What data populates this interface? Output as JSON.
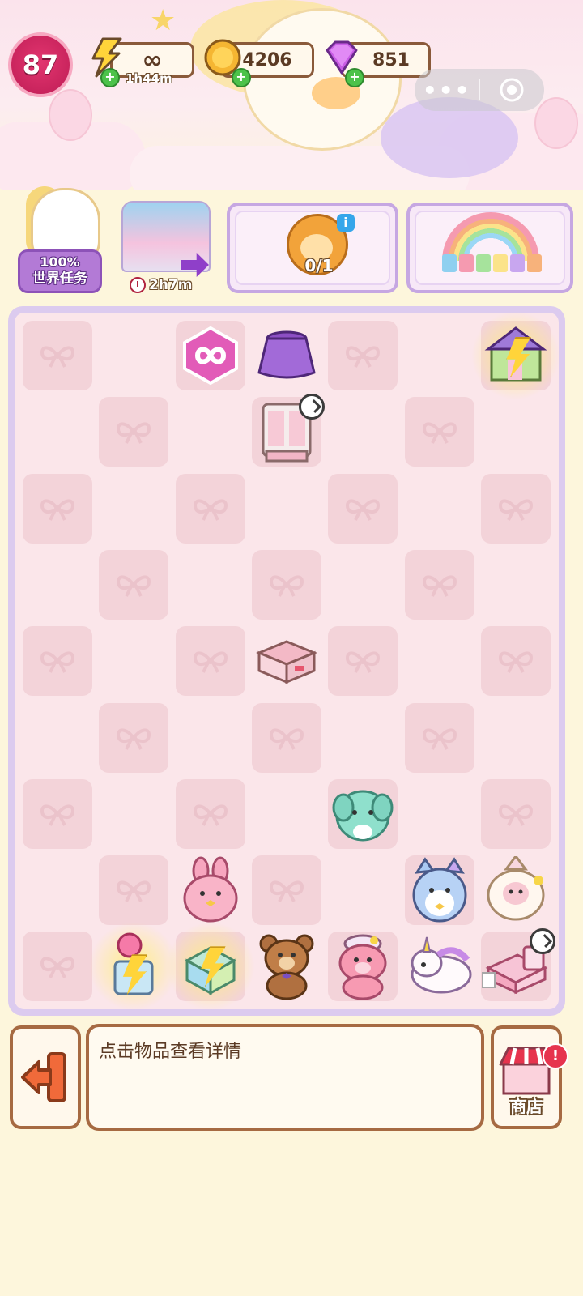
{
  "player": {
    "level": "87"
  },
  "resources": {
    "energy": {
      "value": "∞",
      "timer": "1h44m"
    },
    "coins": {
      "value": "4206"
    },
    "gems": {
      "value": "851"
    }
  },
  "world_task": {
    "percent": "100%",
    "label": "世界任务"
  },
  "event": {
    "timer": "2h7m"
  },
  "order": {
    "progress": "0/1"
  },
  "description": {
    "text": "点击物品查看详情"
  },
  "shop": {
    "label": "商店"
  },
  "colors": {
    "level_badge": "#c9245d",
    "panel_border": "#c6a7e2",
    "board_bg": "#fbe6ea",
    "frame_brown": "#a66a42"
  },
  "board": {
    "columns": 7,
    "rows": 9,
    "items": [
      {
        "row": 0,
        "col": 2,
        "name": "infinity-energy-token"
      },
      {
        "row": 0,
        "col": 3,
        "name": "purple-skirt"
      },
      {
        "row": 0,
        "col": 6,
        "name": "house-energy-generator"
      },
      {
        "row": 1,
        "col": 3,
        "name": "wardrobe",
        "timer": true
      },
      {
        "row": 4,
        "col": 3,
        "name": "pink-drawer"
      },
      {
        "row": 6,
        "col": 4,
        "name": "mint-elephant-plush"
      },
      {
        "row": 7,
        "col": 2,
        "name": "pink-bunny-plush"
      },
      {
        "row": 7,
        "col": 5,
        "name": "blue-cat-plush"
      },
      {
        "row": 7,
        "col": 6,
        "name": "sheep-plush"
      },
      {
        "row": 8,
        "col": 1,
        "name": "balloon-energy-generator"
      },
      {
        "row": 8,
        "col": 2,
        "name": "gift-box-energy-generator"
      },
      {
        "row": 8,
        "col": 3,
        "name": "brown-teddy-bear"
      },
      {
        "row": 8,
        "col": 4,
        "name": "pink-teddy-bear"
      },
      {
        "row": 8,
        "col": 5,
        "name": "unicorn-plush"
      },
      {
        "row": 8,
        "col": 6,
        "name": "pink-bed",
        "timer": true
      }
    ]
  }
}
